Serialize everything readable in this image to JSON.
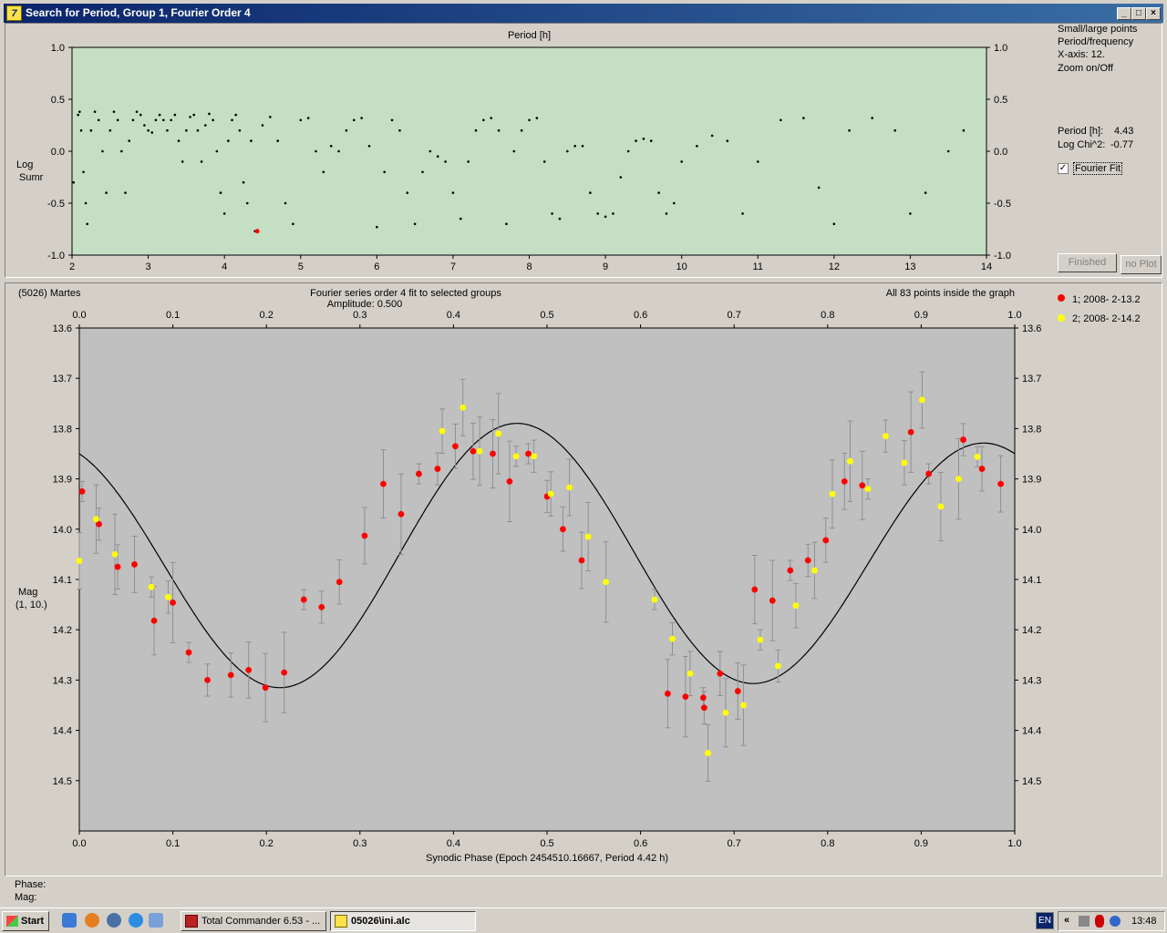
{
  "window": {
    "title": "Search for Period, Group 1, Fourier Order 4",
    "icon_letter": "7",
    "buttons": [
      "_",
      "□",
      "×"
    ]
  },
  "period_plot": {
    "top_label": "Period [h]",
    "ylabel_line1": "Log",
    "ylabel_line2": "Sumr",
    "x_ticks": [
      "2",
      "3",
      "4",
      "5",
      "6",
      "7",
      "8",
      "9",
      "10",
      "11",
      "12",
      "13",
      "14"
    ],
    "y_ticks_left": [
      "1.0",
      "0.5",
      "0.0",
      "-0.5",
      "-1.0"
    ],
    "y_ticks_right": [
      "1.0",
      "0.5",
      "0.0",
      "-0.5",
      "-1.0"
    ],
    "xlim": [
      2,
      14
    ],
    "ylim": [
      -1.0,
      1.0
    ],
    "background": "#c4dfc4",
    "best_point": {
      "x": 4.43,
      "y": -0.77
    }
  },
  "side_panel": {
    "options": [
      "Small/large points",
      "Period/frequency",
      "X-axis: 12.",
      "Zoom on/Off"
    ],
    "period_label": "Period [h]:",
    "period_value": "4.43",
    "chi_label": "Log Chi^2:",
    "chi_value": "-0.77",
    "fourier_fit_label": "Fourier Fit",
    "fourier_fit_checked": true,
    "finished_button": "Finished",
    "noplot_button": "no Plot"
  },
  "lightcurve": {
    "object_label": "(5026) Martes",
    "title": "Fourier series order 4 fit to selected groups",
    "amplitude": "Amplitude: 0.500",
    "points_info": "All 83 points inside the graph",
    "ylabel_line1": "Mag",
    "ylabel_line2": "(1, 10.)",
    "xlabel": "Synodic Phase (Epoch 2454510.16667, Period 4.42 h)",
    "x_ticks": [
      "0.0",
      "0.1",
      "0.2",
      "0.3",
      "0.4",
      "0.5",
      "0.6",
      "0.7",
      "0.8",
      "0.9",
      "1.0"
    ],
    "y_ticks": [
      "13.6",
      "13.7",
      "13.8",
      "13.9",
      "14.0",
      "14.1",
      "14.2",
      "14.3",
      "14.4",
      "14.5"
    ],
    "legend": [
      {
        "label": "1; 2008- 2-13.2",
        "color": "#ff0000"
      },
      {
        "label": "2; 2008- 2-14.2",
        "color": "#ffff00"
      }
    ],
    "background": "#c0c0c0"
  },
  "status": {
    "phase_label": "Phase:",
    "mag_label": "Mag:"
  },
  "taskbar": {
    "start_label": "Start",
    "tasks": [
      "Total Commander 6.53 - ...",
      "05026\\ini.alc"
    ],
    "lang": "EN",
    "clock": "13:48"
  },
  "chart_data": [
    {
      "type": "scatter",
      "title": "",
      "xlabel": "Period [h]",
      "ylabel": "Log Sumr",
      "xlim": [
        2,
        14
      ],
      "ylim": [
        -1.0,
        1.0
      ],
      "grid": false,
      "series": [
        {
          "name": "",
          "x": [
            2.02,
            2.08,
            2.1,
            2.12,
            2.15,
            2.18,
            2.2,
            2.25,
            2.3,
            2.35,
            2.4,
            2.45,
            2.5,
            2.55,
            2.6,
            2.65,
            2.7,
            2.75,
            2.8,
            2.85,
            2.9,
            2.95,
            3.0,
            3.05,
            3.1,
            3.15,
            3.2,
            3.25,
            3.3,
            3.35,
            3.4,
            3.45,
            3.5,
            3.55,
            3.6,
            3.65,
            3.7,
            3.75,
            3.8,
            3.85,
            3.9,
            3.95,
            4.0,
            4.05,
            4.1,
            4.15,
            4.2,
            4.25,
            4.3,
            4.35,
            4.4,
            4.5,
            4.6,
            4.7,
            4.8,
            4.9,
            5.0,
            5.1,
            5.2,
            5.3,
            5.4,
            5.5,
            5.6,
            5.7,
            5.8,
            5.9,
            6.0,
            6.1,
            6.2,
            6.3,
            6.4,
            6.5,
            6.6,
            6.7,
            6.8,
            6.9,
            7.0,
            7.1,
            7.2,
            7.3,
            7.4,
            7.5,
            7.6,
            7.7,
            7.8,
            7.9,
            8.0,
            8.1,
            8.2,
            8.3,
            8.4,
            8.5,
            8.6,
            8.7,
            8.8,
            8.9,
            9.0,
            9.1,
            9.2,
            9.3,
            9.4,
            9.5,
            9.6,
            9.7,
            9.8,
            9.9,
            10.0,
            10.2,
            10.4,
            10.6,
            10.8,
            11.0,
            11.3,
            11.6,
            11.8,
            12.0,
            12.2,
            12.5,
            12.8,
            13.0,
            13.2,
            13.5,
            13.7
          ],
          "y": [
            -0.3,
            0.35,
            0.38,
            0.2,
            -0.2,
            -0.5,
            -0.7,
            0.2,
            0.38,
            0.3,
            0.0,
            -0.4,
            0.2,
            0.38,
            0.3,
            0.0,
            -0.4,
            0.1,
            0.3,
            0.38,
            0.35,
            0.25,
            0.2,
            0.18,
            0.3,
            0.35,
            0.3,
            0.2,
            0.3,
            0.35,
            0.1,
            -0.1,
            0.2,
            0.33,
            0.35,
            0.2,
            -0.1,
            0.25,
            0.36,
            0.3,
            0.0,
            -0.4,
            -0.6,
            0.1,
            0.3,
            0.35,
            0.2,
            -0.3,
            -0.5,
            0.1,
            -0.77,
            0.25,
            0.33,
            0.1,
            -0.5,
            -0.7,
            0.3,
            0.32,
            0.0,
            -0.2,
            0.05,
            0.0,
            0.2,
            0.3,
            0.32,
            0.05,
            -0.73,
            -0.2,
            0.3,
            0.2,
            -0.4,
            -0.7,
            -0.2,
            0.0,
            -0.05,
            -0.1,
            -0.4,
            -0.65,
            -0.1,
            0.2,
            0.3,
            0.32,
            0.2,
            -0.7,
            0.0,
            0.2,
            0.3,
            0.32,
            -0.1,
            -0.6,
            -0.65,
            0.0,
            0.05,
            0.05,
            -0.4,
            -0.6,
            -0.63,
            -0.6,
            -0.25,
            0.0,
            0.1,
            0.12,
            0.1,
            -0.4,
            -0.6,
            -0.5,
            -0.1,
            0.05,
            0.15,
            0.1,
            -0.6,
            -0.1,
            0.3,
            0.32,
            -0.35,
            -0.7,
            0.2,
            0.32,
            0.2,
            -0.6,
            -0.4,
            0.0,
            0.2
          ],
          "color": "#000000"
        },
        {
          "name": "",
          "x": [
            4.43
          ],
          "y": [
            -0.77
          ],
          "color": "#ff0000"
        }
      ]
    },
    {
      "type": "scatter",
      "title": "Fourier series order 4 fit to selected groups",
      "xlabel": "Synodic Phase (Epoch 2454510.16667, Period 4.42 h)",
      "ylabel": "Mag (1, 10.)",
      "xlim": [
        0.0,
        1.0
      ],
      "ylim": [
        13.6,
        14.6
      ],
      "y_inverted": true,
      "grid": false,
      "fit_curve": {
        "mean": 14.06,
        "a1": 0.02,
        "b1": 0.0,
        "a2": -0.23,
        "b2": 0.1,
        "comment": "Fourier fit line"
      },
      "series": [
        {
          "name": "1; 2008- 2-13.2",
          "color": "#ff0000",
          "x": [
            0.003,
            0.021,
            0.041,
            0.059,
            0.08,
            0.1,
            0.117,
            0.137,
            0.162,
            0.181,
            0.199,
            0.219,
            0.24,
            0.259,
            0.278,
            0.305,
            0.325,
            0.344,
            0.363,
            0.383,
            0.402,
            0.421,
            0.442,
            0.46,
            0.48,
            0.5,
            0.517,
            0.537,
            0.629,
            0.648,
            0.667,
            0.668,
            0.685,
            0.704,
            0.722,
            0.741,
            0.76,
            0.779,
            0.798,
            0.818,
            0.837,
            0.889,
            0.908,
            0.945,
            0.965,
            0.985
          ],
          "y": [
            13.925,
            13.99,
            14.075,
            14.07,
            14.182,
            14.146,
            14.245,
            14.3,
            14.29,
            14.28,
            14.315,
            14.285,
            14.14,
            14.155,
            14.105,
            14.013,
            13.91,
            13.97,
            13.89,
            13.88,
            13.835,
            13.845,
            13.85,
            13.905,
            13.85,
            13.935,
            14.0,
            14.062,
            14.327,
            14.333,
            14.335,
            14.355,
            14.287,
            14.322,
            14.12,
            14.142,
            14.082,
            14.062,
            14.022,
            13.905,
            13.913,
            13.807,
            13.89,
            13.822,
            13.88,
            13.91
          ]
        },
        {
          "name": "2; 2008- 2-14.2",
          "color": "#ffff00",
          "x": [
            0.0,
            0.018,
            0.038,
            0.077,
            0.095,
            0.388,
            0.41,
            0.428,
            0.448,
            0.467,
            0.486,
            0.504,
            0.524,
            0.544,
            0.563,
            0.615,
            0.634,
            0.653,
            0.672,
            0.691,
            0.71,
            0.728,
            0.747,
            0.766,
            0.786,
            0.805,
            0.824,
            0.843,
            0.862,
            0.882,
            0.901,
            0.921,
            0.94,
            0.96
          ],
          "y": [
            14.063,
            13.98,
            14.05,
            14.115,
            14.135,
            13.805,
            13.758,
            13.845,
            13.81,
            13.855,
            13.855,
            13.93,
            13.917,
            14.015,
            14.105,
            14.14,
            14.218,
            14.287,
            14.445,
            14.365,
            14.35,
            14.22,
            14.272,
            14.152,
            14.082,
            13.93,
            13.865,
            13.92,
            13.815,
            13.868,
            13.743,
            13.955,
            13.9,
            13.856
          ]
        }
      ]
    }
  ]
}
